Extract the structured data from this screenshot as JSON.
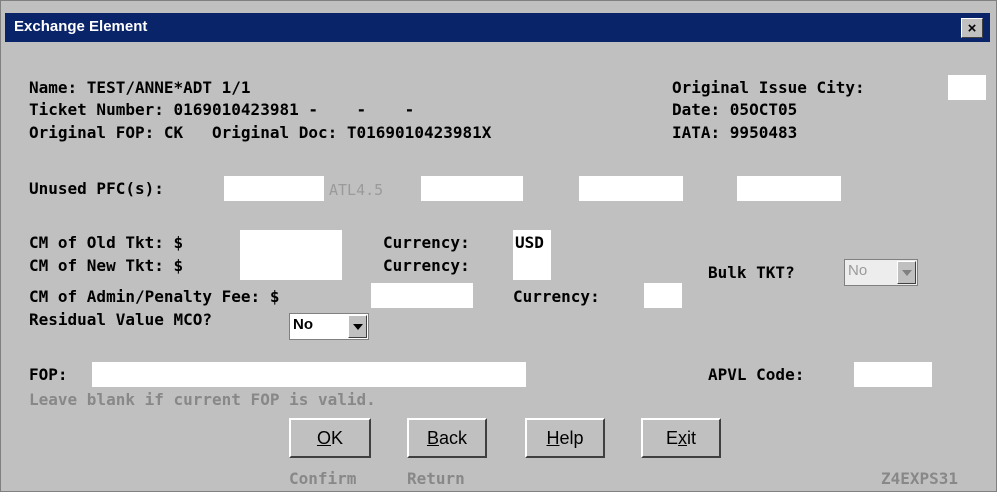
{
  "window": {
    "title": "Exchange Element",
    "close_glyph": "×"
  },
  "lines": {
    "name": "Name: TEST/ANNE*ADT 1/1",
    "original_issue_city": "Original Issue City:",
    "ticket_number": "Ticket Number: 0169010423981 -    -    -",
    "date": "Date: 05OCT05",
    "original_fop_doc": "Original FOP: CK   Original Doc: T0169010423981X",
    "iata": "IATA: 9950483"
  },
  "pfc": {
    "label": "Unused PFC(s):",
    "value": "ATL4.5"
  },
  "cm": {
    "old_label": "CM of Old Tkt: $",
    "currency_label_1": "Currency:",
    "currency_value_1": "USD",
    "new_label": "CM of New Tkt: $",
    "currency_label_2": "Currency:",
    "bulk_label": "Bulk TKT?",
    "bulk_value": "No",
    "admin_label": "CM of Admin/Penalty Fee: $",
    "currency_label_3": "Currency:",
    "residual_label": "Residual Value MCO?",
    "residual_value": "No"
  },
  "fop": {
    "label": "FOP:",
    "apvl_label": "APVL Code:",
    "hint": "Leave blank if current FOP is valid."
  },
  "buttons": [
    {
      "key": "O",
      "rest": "K"
    },
    {
      "key": "B",
      "rest": "ack"
    },
    {
      "key": "H",
      "rest": "elp"
    },
    {
      "pre": "E",
      "key": "x",
      "rest": "it"
    }
  ],
  "footer": {
    "confirm": "Confirm",
    "return": "Return",
    "screen_id": "Z4EXPS31"
  }
}
